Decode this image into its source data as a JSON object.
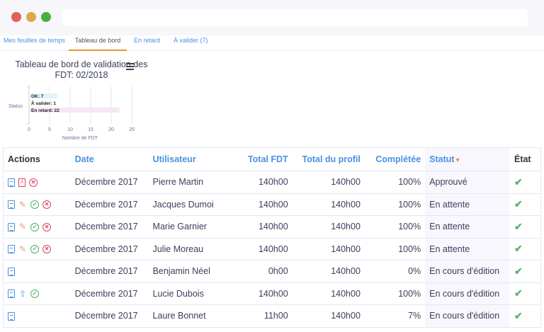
{
  "window": {
    "controls": {
      "close": "#e0605a",
      "minimize": "#e0a848",
      "maximize": "#4caf3c"
    }
  },
  "tabs": [
    {
      "label": "Mes feuilles de temps"
    },
    {
      "label": "Tableau de bord",
      "active": true
    },
    {
      "label": "En retard"
    },
    {
      "label": "À valider (7)"
    }
  ],
  "chart_data": {
    "type": "bar",
    "orientation": "horizontal",
    "title": "Tableau de bord de validation des FDT: 02/2018",
    "xlabel": "Nombre de FDT",
    "ylabel": "Status",
    "xlim": [
      0,
      25
    ],
    "xticks": [
      "0",
      "5",
      "10",
      "15",
      "20",
      "25"
    ],
    "grid": true,
    "categories": [
      "OK",
      "À valider",
      "En retard"
    ],
    "values": [
      7,
      1,
      22
    ],
    "labels": [
      "OK: 7",
      "À valider: 1",
      "En retard: 22"
    ],
    "colors": [
      "#e3f3fa",
      "#fdf3e6",
      "#f7e6f6"
    ]
  },
  "table": {
    "headers": [
      "Actions",
      "Date",
      "Utilisateur",
      "Total FDT",
      "Total du profil",
      "Complétée",
      "Statut",
      "État"
    ],
    "rows": [
      {
        "actions": [
          "view",
          "pdf",
          "reject"
        ],
        "date": "Décembre 2017",
        "user": "Pierre Martin",
        "total": "140h00",
        "profile": "140h00",
        "done": "100%",
        "status": "Approuvé"
      },
      {
        "actions": [
          "view",
          "edit",
          "approve",
          "reject"
        ],
        "date": "Décembre 2017",
        "user": "Jacques Dumoi",
        "total": "140h00",
        "profile": "140h00",
        "done": "100%",
        "status": "En attente"
      },
      {
        "actions": [
          "view",
          "edit",
          "approve",
          "reject"
        ],
        "date": "Décembre 2017",
        "user": "Marie Garnier",
        "total": "140h00",
        "profile": "140h00",
        "done": "100%",
        "status": "En attente"
      },
      {
        "actions": [
          "view",
          "edit",
          "approve",
          "reject"
        ],
        "date": "Décembre 2017",
        "user": "Julie Moreau",
        "total": "140h00",
        "profile": "140h00",
        "done": "100%",
        "status": "En attente"
      },
      {
        "actions": [
          "view"
        ],
        "date": "Décembre 2017",
        "user": "Benjamin Néel",
        "total": "0h00",
        "profile": "140h00",
        "done": "0%",
        "status": "En cours d'édition"
      },
      {
        "actions": [
          "view",
          "submit",
          "approve"
        ],
        "date": "Décembre 2017",
        "user": "Lucie Dubois",
        "total": "140h00",
        "profile": "140h00",
        "done": "100%",
        "status": "En cours d'édition"
      },
      {
        "actions": [
          "view"
        ],
        "date": "Décembre 2017",
        "user": "Laure Bonnet",
        "total": "11h00",
        "profile": "140h00",
        "done": "7%",
        "status": "En cours d'édition"
      }
    ]
  }
}
